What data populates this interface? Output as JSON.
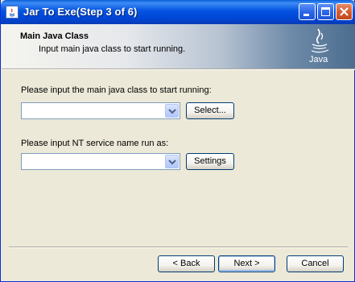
{
  "window": {
    "title": "Jar To Exe(Step 3 of 6)",
    "icon": "java-app-icon",
    "controls": [
      "minimize-icon",
      "maximize-icon",
      "close-icon"
    ]
  },
  "header": {
    "title": "Main Java Class",
    "subtitle": "Input main java class to start running.",
    "logo_text": "Java"
  },
  "form": {
    "main_class_label": "Please input the main java class to start running:",
    "main_class_value": "",
    "select_button": "Select...",
    "service_label": "Please input NT service name run as:",
    "service_value": "",
    "settings_button": "Settings"
  },
  "footer": {
    "back_button": "< Back",
    "next_button": "Next >",
    "cancel_button": "Cancel"
  },
  "colors": {
    "titlebar": "#0453e1",
    "dialog_bg": "#ece9d8",
    "field_border": "#7f9db9"
  }
}
